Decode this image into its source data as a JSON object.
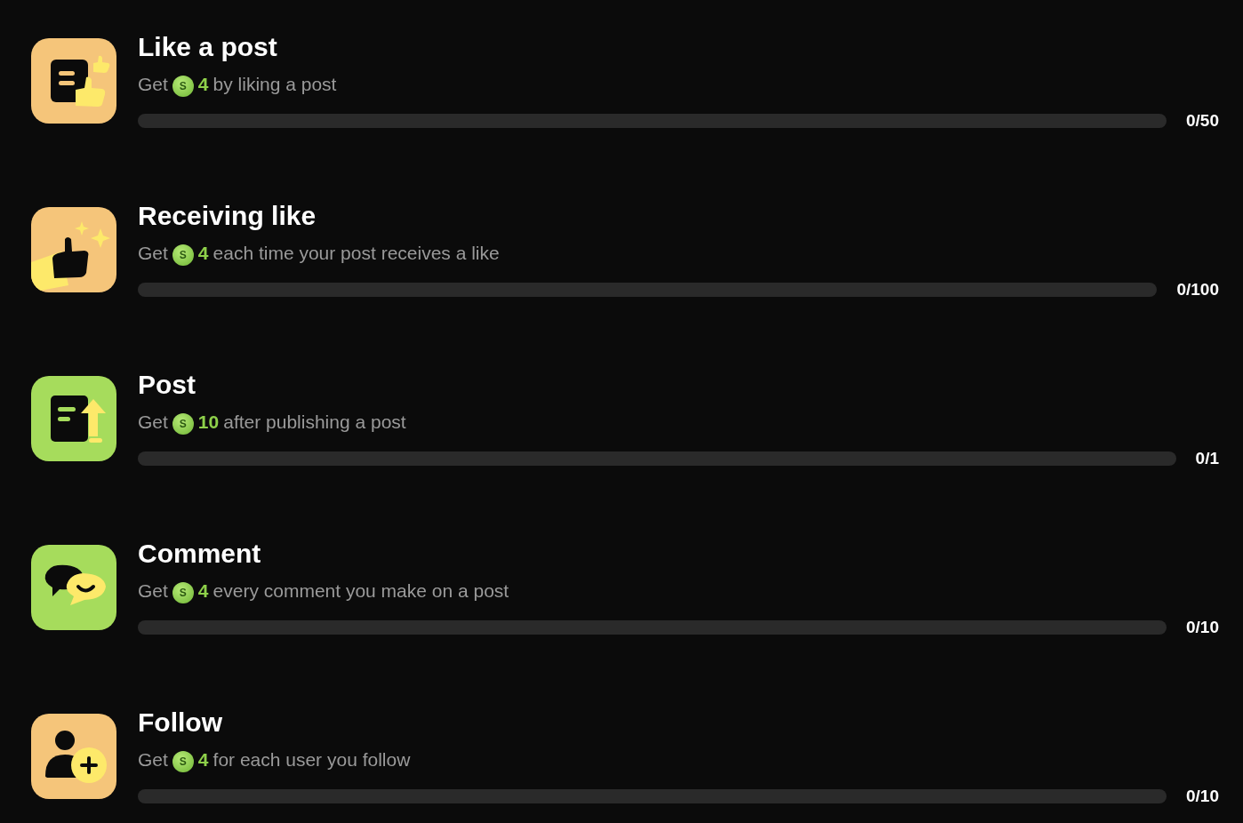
{
  "tasks": [
    {
      "kind": "like_post",
      "color": "#f5c57a",
      "title": "Like a post",
      "prefix": "Get",
      "coin": "S",
      "amount": "4",
      "suffix": "by liking a post",
      "count": "0/50"
    },
    {
      "kind": "receive_like",
      "color": "#f5c57a",
      "title": "Receiving like",
      "prefix": "Get",
      "coin": "S",
      "amount": "4",
      "suffix": "each time your post receives a like",
      "count": "0/100"
    },
    {
      "kind": "post",
      "color": "#a6dc5c",
      "title": "Post",
      "prefix": "Get",
      "coin": "S",
      "amount": "10",
      "suffix": "after publishing a post",
      "count": "0/1"
    },
    {
      "kind": "comment",
      "color": "#a6dc5c",
      "title": "Comment",
      "prefix": "Get",
      "coin": "S",
      "amount": "4",
      "suffix": "every comment you make on a post",
      "count": "0/10"
    },
    {
      "kind": "follow",
      "color": "#f5c57a",
      "title": "Follow",
      "prefix": "Get",
      "coin": "S",
      "amount": "4",
      "suffix": "for each user you follow",
      "count": "0/10"
    }
  ]
}
